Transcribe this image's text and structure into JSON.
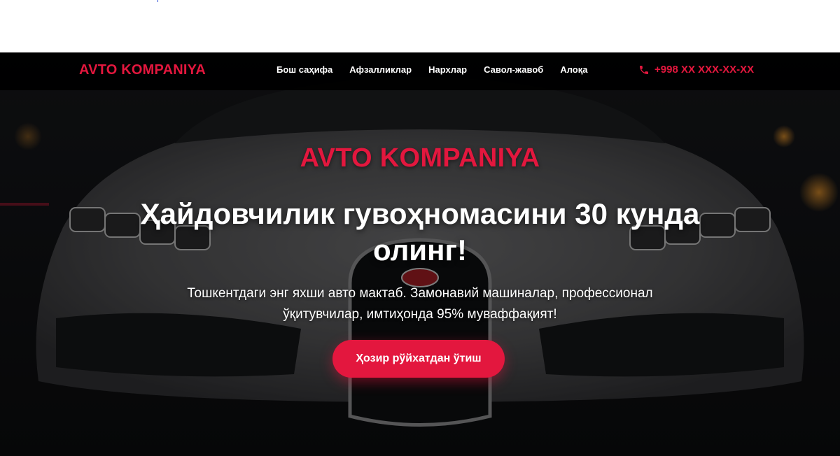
{
  "brand": "AVTO KOMPANIYA",
  "nav": {
    "items": [
      {
        "label": "Бош саҳифа"
      },
      {
        "label": "Афзалликлар"
      },
      {
        "label": "Нархлар"
      },
      {
        "label": "Савол-жавоб"
      },
      {
        "label": "Алоқа"
      }
    ],
    "phone": "+998 XX XXX-XX-XX",
    "phone_icon": "phone-icon"
  },
  "hero": {
    "brand": "AVTO KOMPANIYA",
    "title": "Ҳайдовчилик гувоҳномасини 30 кунда олинг!",
    "subtitle": "Тошкентдаги энг яхши авто мактаб. Замонавий машиналар, профессионал ўқитувчилар, имтиҳонда 95% муваффақият!",
    "cta_label": "Ҳозир рўйхатдан ўтиш",
    "car_badge": "BUGATTI"
  },
  "colors": {
    "accent": "#e3173e",
    "navbar": "#000000",
    "text": "#ffffff"
  }
}
